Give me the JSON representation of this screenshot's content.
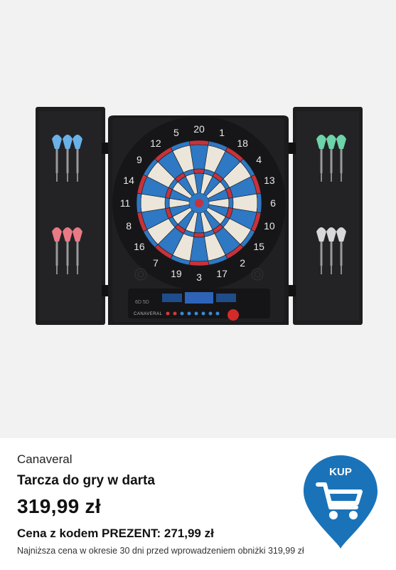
{
  "product": {
    "image_alt": "electronic-dartboard-cabinet",
    "board_brand": "CANAVERAL",
    "brand": "Canaveral",
    "title": "Tarcza do gry w darta",
    "price": "319,99 zł",
    "promo": "Cena z kodem PREZENT: 271,99 zł",
    "lowest_price_note": "Najniższa cena w okresie 30 dni przed wprowadzeniem obniżki 319,99 zł"
  },
  "buy_button": {
    "label": "KUP",
    "color": "#1a73b8",
    "icon": "shopping-cart-icon"
  },
  "board": {
    "numbers": [
      "20",
      "1",
      "18",
      "4",
      "13",
      "6",
      "10",
      "15",
      "2",
      "17",
      "3",
      "19",
      "7",
      "16",
      "8",
      "11",
      "14",
      "9",
      "12",
      "5"
    ],
    "colors": {
      "blue": "#2e78c4",
      "cream": "#ece6da",
      "red": "#c8323a",
      "cabinet": "#1c1c1e"
    }
  }
}
